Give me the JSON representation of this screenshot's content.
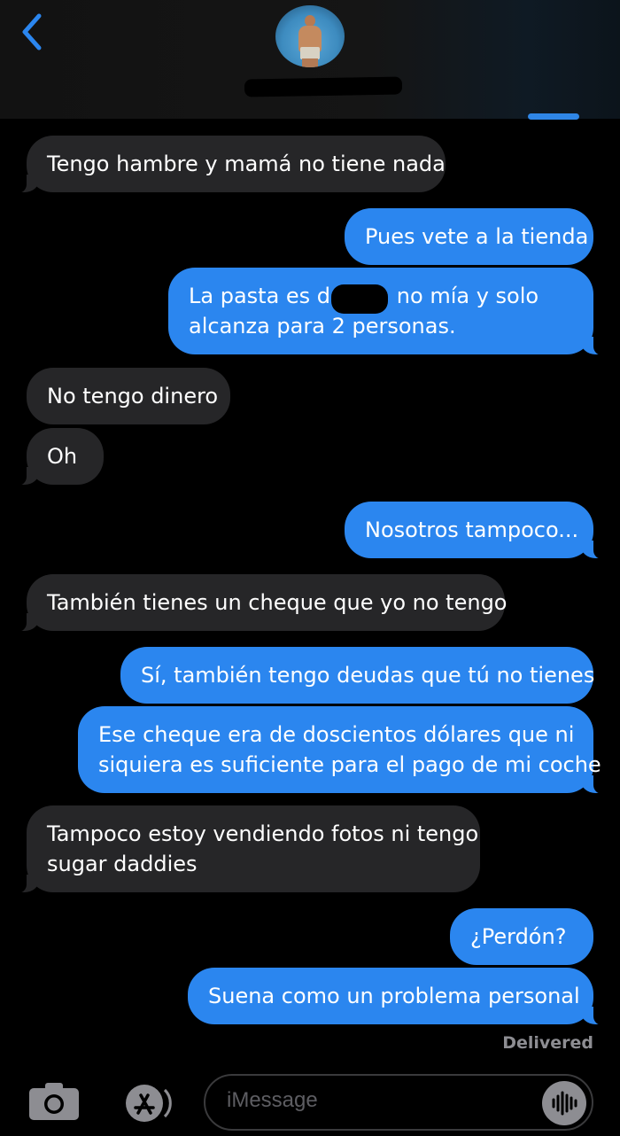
{
  "header": {
    "back_icon": "chevron-left-icon",
    "accent_color": "#2b86ef"
  },
  "messages": [
    {
      "side": "received",
      "text": "Tengo hambre y mamá no tiene nada"
    },
    {
      "side": "sent",
      "text": "Pues vete a la tienda"
    },
    {
      "side": "sent",
      "line1_before": "La pasta es de",
      "line1_after": "no mía y solo",
      "line2": "alcanza para 2 personas."
    },
    {
      "side": "received",
      "text": "No tengo dinero"
    },
    {
      "side": "received",
      "text": "Oh"
    },
    {
      "side": "sent",
      "text": "Nosotros tampoco..."
    },
    {
      "side": "received",
      "text": "También tienes un cheque que yo no tengo"
    },
    {
      "side": "sent",
      "text": "Sí, también tengo deudas que tú no tienes"
    },
    {
      "side": "sent",
      "line1": "Ese cheque era de doscientos dólares que ni",
      "line2": "siquiera es suficiente para el pago de mi coche"
    },
    {
      "side": "received",
      "line1": "Tampoco estoy vendiendo fotos ni tengo",
      "line2": "sugar daddies"
    },
    {
      "side": "sent",
      "text": "¿Perdón?"
    },
    {
      "side": "sent",
      "text": "Suena como un problema personal"
    }
  ],
  "status": {
    "delivered": "Delivered"
  },
  "composer": {
    "placeholder": "iMessage",
    "camera_icon": "camera-icon",
    "apps_icon": "app-store-icon",
    "audio_icon": "audio-waveform-icon"
  }
}
